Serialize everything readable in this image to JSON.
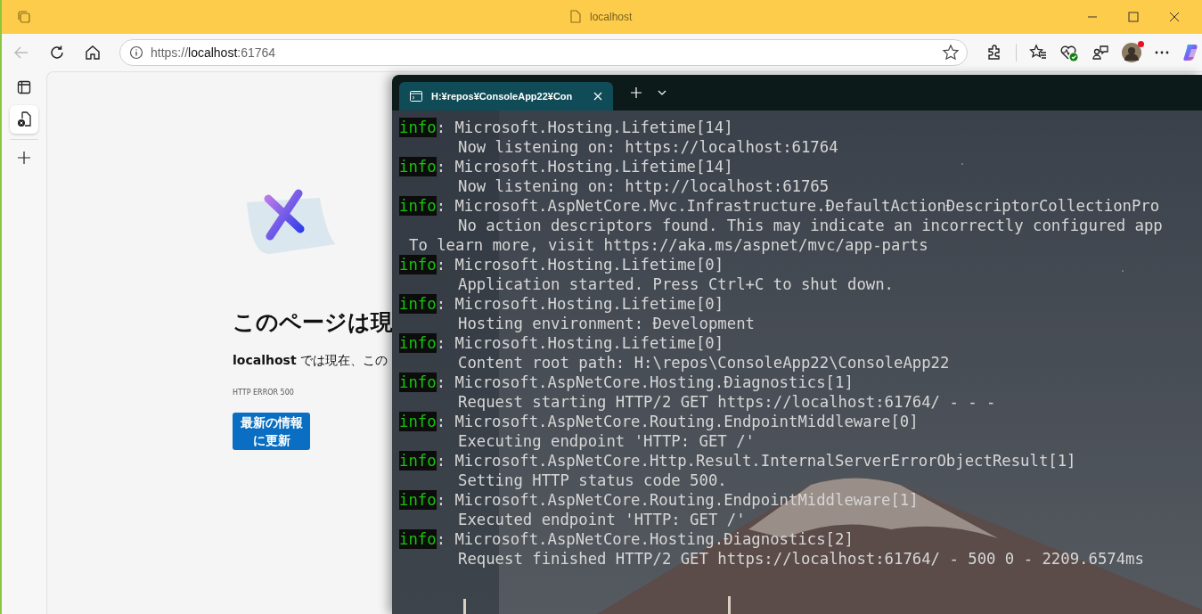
{
  "browser": {
    "title": "localhost",
    "back_button": {
      "disabled": true
    },
    "address": {
      "scheme": "https://",
      "host": "localhost",
      "port": ":61764"
    },
    "profile": {
      "notification": true
    },
    "vertical_tabs": [
      {
        "selected": true
      }
    ]
  },
  "page": {
    "heading": "このページは現",
    "message": "**localhost** では現在、この",
    "error_code": "HTTP ERROR 500",
    "button": "最新の情報に更新"
  },
  "terminal": {
    "tabs": [
      {
        "title": "H:¥repos¥ConsoleApp22¥Con",
        "selected": true
      }
    ],
    "lines": [
      {
        "kind": "log",
        "level": "info",
        "text": ": Microsoft.Hosting.Lifetime[14]"
      },
      {
        "kind": "message",
        "text": "Now listening on: https://localhost:61764"
      },
      {
        "kind": "log",
        "level": "info",
        "text": ": Microsoft.Hosting.Lifetime[14]"
      },
      {
        "kind": "message",
        "text": "Now listening on: http://localhost:61765"
      },
      {
        "kind": "log",
        "level": "info",
        "text": ": Microsoft.AspNetCore.Mvc.Infrastructure.ĐefaultActionĐescriptorCollectionPro"
      },
      {
        "kind": "message",
        "text": "No action descriptors found. This may indicate an incorrectly configured app"
      },
      {
        "kind": "note",
        "text": "To learn more, visit https://aka.ms/aspnet/mvc/app-parts"
      },
      {
        "kind": "log",
        "level": "info",
        "text": ": Microsoft.Hosting.Lifetime[0]"
      },
      {
        "kind": "message",
        "text": "Application started. Press Ctrl+C to shut down."
      },
      {
        "kind": "log",
        "level": "info",
        "text": ": Microsoft.Hosting.Lifetime[0]"
      },
      {
        "kind": "message",
        "text": "Hosting environment: Đevelopment"
      },
      {
        "kind": "log",
        "level": "info",
        "text": ": Microsoft.Hosting.Lifetime[0]"
      },
      {
        "kind": "message",
        "text": "Content root path: H:\\repos\\ConsoleApp22\\ConsoleApp22"
      },
      {
        "kind": "log",
        "level": "info",
        "text": ": Microsoft.AspNetCore.Hosting.Điagnostics[1]"
      },
      {
        "kind": "message",
        "text": "Request starting HTTP/2 GET https://localhost:61764/ - - -"
      },
      {
        "kind": "log",
        "level": "info",
        "text": ": Microsoft.AspNetCore.Routing.EndpointMiddleware[0]"
      },
      {
        "kind": "message",
        "text": "Executing endpoint 'HTTP: GET /'"
      },
      {
        "kind": "log",
        "level": "info",
        "text": ": Microsoft.AspNetCore.Http.Result.InternalServerErrorObjectResult[1]"
      },
      {
        "kind": "message",
        "text": "Setting HTTP status code 500."
      },
      {
        "kind": "log",
        "level": "info",
        "text": ": Microsoft.AspNetCore.Routing.EndpointMiddleware[1]"
      },
      {
        "kind": "message",
        "text": "Executed endpoint 'HTTP: GET /'"
      },
      {
        "kind": "log",
        "level": "info",
        "text": ": Microsoft.AspNetCore.Hosting.Điagnostics[2]"
      },
      {
        "kind": "message",
        "text": "Request finished HTTP/2 GET https://localhost:61764/ - 500 0 - 2209.6574ms"
      }
    ]
  }
}
